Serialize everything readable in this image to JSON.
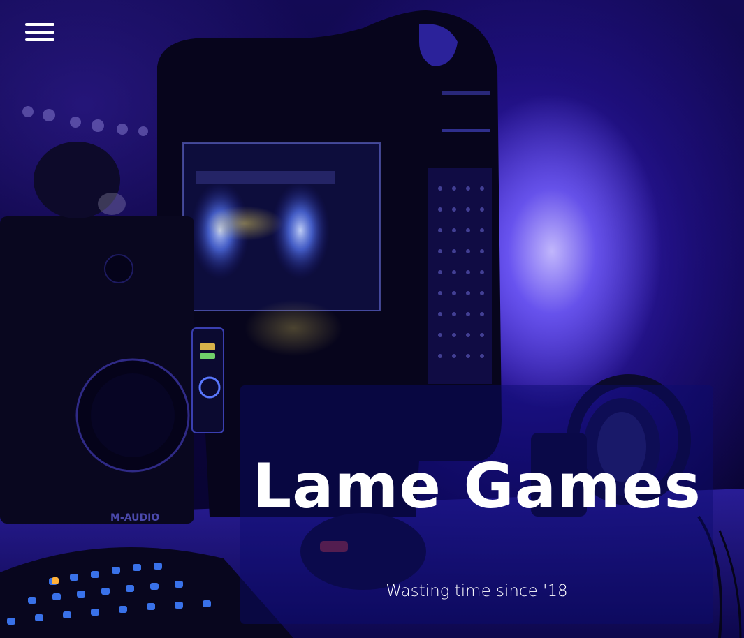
{
  "nav": {
    "menu_icon": "hamburger-menu-icon"
  },
  "hero": {
    "title": "Lame Games",
    "tagline": "Wasting time since '18",
    "background_image": "dark gaming desk with PC case, speaker, headphones and keyboard under blue light",
    "speaker_brand": "M-AUDIO"
  },
  "colors": {
    "text": "#ffffff",
    "panel_overlay": "rgba(10,10,110,0.45)",
    "accent_blue": "#3a2ce0",
    "background_dark": "#07032a"
  }
}
